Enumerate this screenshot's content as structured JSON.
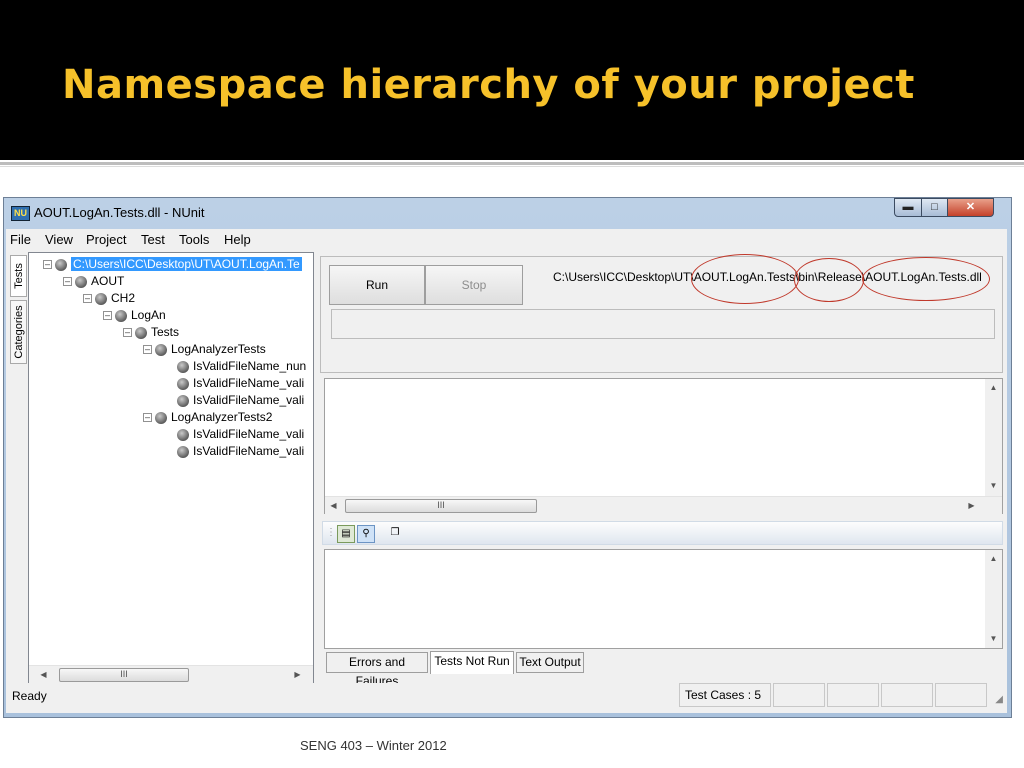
{
  "slide": {
    "title": "Namespace hierarchy of your project",
    "footer": "SENG 403 – Winter 2012",
    "accent_color": "#f6c12a"
  },
  "window": {
    "title": "AOUT.LogAn.Tests.dll - NUnit",
    "icon": "nunit-app-icon",
    "icon_text": "NU",
    "controls": [
      "minimize-icon",
      "maximize-icon",
      "close-icon"
    ]
  },
  "menu": {
    "items": [
      "File",
      "View",
      "Project",
      "Test",
      "Tools",
      "Help"
    ]
  },
  "side_tabs": {
    "tests": "Tests",
    "categories": "Categories"
  },
  "tree": {
    "root": "C:\\Users\\ICC\\Desktop\\UT\\AOUT.LogAn.Te",
    "aout": "AOUT",
    "ch2": "CH2",
    "logan": "LogAn",
    "tests": "Tests",
    "fixture1": "LogAnalyzerTests",
    "f1_items": [
      "IsValidFileName_nun",
      "IsValidFileName_vali",
      "IsValidFileName_vali"
    ],
    "fixture2": "LogAnalyzerTests2",
    "f2_items": [
      "IsValidFileName_vali",
      "IsValidFileName_vali"
    ],
    "scroll_label": "III"
  },
  "run_panel": {
    "run_label": "Run",
    "stop_label": "Stop",
    "path": "C:\\Users\\ICC\\Desktop\\UT\\AOUT.LogAn.Tests\\bin\\Release\\AOUT.LogAn.Tests.dll"
  },
  "results": {
    "scroll_label": "III"
  },
  "bottom_tabs": {
    "errors": "Errors and Failures",
    "not_run": "Tests Not Run",
    "text_output": "Text Output"
  },
  "status": {
    "ready": "Ready",
    "test_cases": "Test Cases : 5"
  },
  "colors": {
    "highlight_ellipse": "#c0392b",
    "selection": "#3399ff"
  }
}
